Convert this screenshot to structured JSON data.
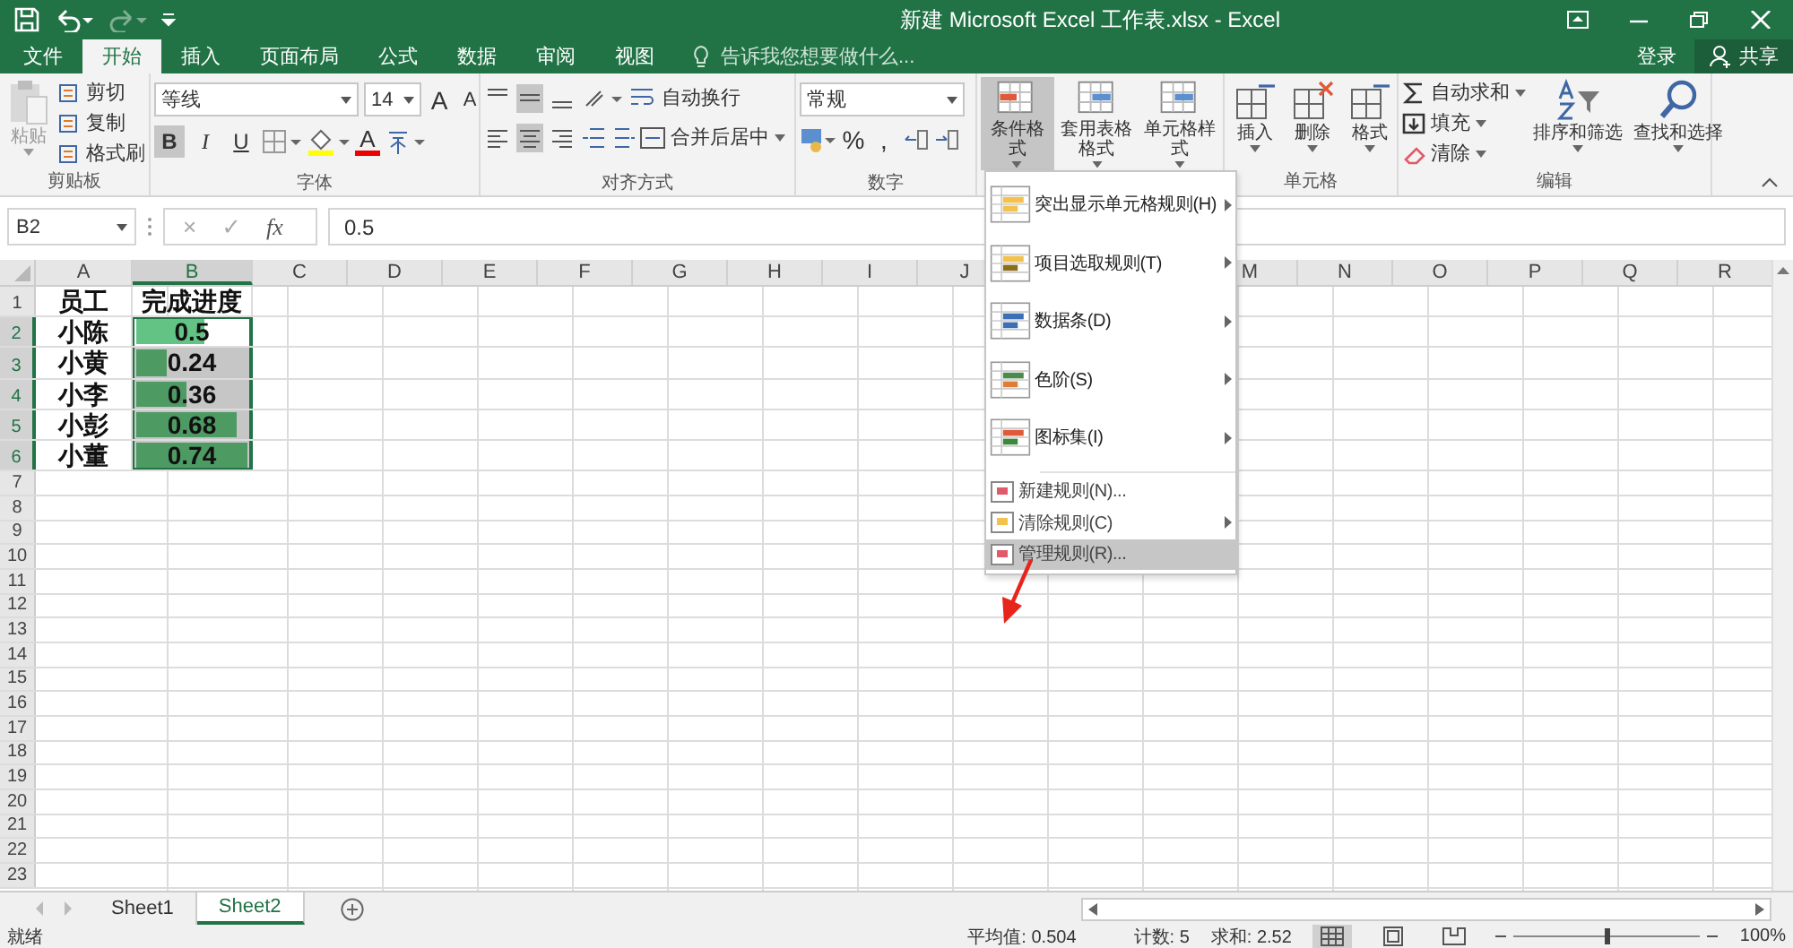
{
  "window": {
    "title": "新建 Microsoft Excel 工作表.xlsx - Excel"
  },
  "tabs": [
    {
      "label": "文件",
      "selected": false
    },
    {
      "label": "开始",
      "selected": true
    },
    {
      "label": "插入",
      "selected": false
    },
    {
      "label": "页面布局",
      "selected": false
    },
    {
      "label": "公式",
      "selected": false
    },
    {
      "label": "数据",
      "selected": false
    },
    {
      "label": "审阅",
      "selected": false
    },
    {
      "label": "视图",
      "selected": false
    }
  ],
  "tell_me": {
    "placeholder": "告诉我您想要做什么..."
  },
  "account": {
    "sign_in": "登录",
    "share": "共享"
  },
  "clipboard": {
    "label": "剪贴板",
    "paste": "粘贴",
    "items": [
      "剪切",
      "复制",
      "格式刷"
    ]
  },
  "font": {
    "label": "字体",
    "font_name": "等线",
    "font_size": "14",
    "size_buttons": [
      "A",
      "A"
    ],
    "font_color": "A",
    "styles": [
      {
        "label": "B",
        "selected": true
      },
      {
        "label": "I",
        "selected": false
      },
      {
        "label": "U",
        "selected": false
      }
    ]
  },
  "alignment": {
    "label": "对齐方式",
    "wrap": "自动换行",
    "merge": "合并后居中",
    "vertical": [
      {
        "selected": false
      },
      {
        "selected": true
      },
      {
        "selected": false
      }
    ],
    "horizontal": [
      {
        "selected": false
      },
      {
        "selected": true
      },
      {
        "selected": false
      }
    ]
  },
  "number": {
    "label": "数字",
    "format": "常规",
    "percent": "%",
    "comma": ","
  },
  "styles": {
    "buttons": [
      {
        "label": "条件格式",
        "selected": true
      },
      {
        "label": "套用表格格式",
        "selected": false
      },
      {
        "label": "单元格样式",
        "selected": false
      }
    ]
  },
  "cells": {
    "label": "单元格",
    "buttons": [
      "插入",
      "删除",
      "格式"
    ]
  },
  "editing": {
    "label": "编辑",
    "small": [
      "自动求和",
      "填充",
      "清除"
    ],
    "large": [
      "排序和筛选",
      "查找和选择"
    ]
  },
  "formula_bar": {
    "name_box": "B2",
    "cancel": "×",
    "enter": "✓",
    "fx": "fx",
    "value": "0.5"
  },
  "columns": [
    {
      "label": "A",
      "selected": false
    },
    {
      "label": "B",
      "selected": true
    },
    {
      "label": "C",
      "selected": false
    },
    {
      "label": "D",
      "selected": false
    },
    {
      "label": "E",
      "selected": false
    },
    {
      "label": "F",
      "selected": false
    },
    {
      "label": "G",
      "selected": false
    },
    {
      "label": "H",
      "selected": false
    },
    {
      "label": "I",
      "selected": false
    },
    {
      "label": "J",
      "selected": false
    },
    {
      "label": "M",
      "selected": false
    },
    {
      "label": "N",
      "selected": false
    },
    {
      "label": "O",
      "selected": false
    },
    {
      "label": "P",
      "selected": false
    },
    {
      "label": "Q",
      "selected": false
    },
    {
      "label": "R",
      "selected": false
    }
  ],
  "rows": [
    {
      "number": "1",
      "employee": "员工",
      "progress": "完成进度",
      "selected": false,
      "active": false
    },
    {
      "number": "2",
      "employee": "小陈",
      "progress": "0.5",
      "level": 0.63,
      "selected": true,
      "active": true
    },
    {
      "number": "3",
      "employee": "小黄",
      "progress": "0.24",
      "level": 0.3,
      "selected": true,
      "active": false
    },
    {
      "number": "4",
      "employee": "小李",
      "progress": "0.36",
      "level": 0.47,
      "selected": true,
      "active": false
    },
    {
      "number": "5",
      "employee": "小彭",
      "progress": "0.68",
      "level": 0.9,
      "selected": true,
      "active": false
    },
    {
      "number": "6",
      "employee": "小董",
      "progress": "0.74",
      "level": 1,
      "selected": true,
      "active": false
    }
  ],
  "empty_rows": [
    "7",
    "8",
    "9",
    "10",
    "11",
    "12",
    "13",
    "14",
    "15",
    "16",
    "17",
    "18",
    "19",
    "20",
    "21",
    "22",
    "23"
  ],
  "menu": [
    {
      "label": "突出显示单元格规则(H)",
      "kind": "large",
      "submenu": true,
      "selected": false
    },
    {
      "label": "项目选取规则(T)",
      "kind": "large",
      "submenu": true,
      "selected": false
    },
    {
      "label": "数据条(D)",
      "kind": "large",
      "submenu": true,
      "selected": false
    },
    {
      "label": "色阶(S)",
      "kind": "large",
      "submenu": true,
      "selected": false
    },
    {
      "label": "图标集(I)",
      "kind": "large",
      "submenu": true,
      "selected": false
    },
    {
      "label": "新建规则(N)...",
      "kind": "small",
      "submenu": false,
      "selected": false
    },
    {
      "label": "清除规则(C)",
      "kind": "small",
      "submenu": true,
      "selected": false
    },
    {
      "label": "管理规则(R)...",
      "kind": "small",
      "submenu": false,
      "selected": true
    }
  ],
  "sheet_tabs": [
    {
      "label": "Sheet1",
      "selected": false
    },
    {
      "label": "Sheet2",
      "selected": true
    }
  ],
  "status_bar": {
    "ready": "就绪",
    "average": "平均值: 0.504",
    "count": "计数: 5",
    "sum": "求和: 2.52",
    "zoom": "100%",
    "zoom_slider": {
      "level": 0.5
    }
  }
}
